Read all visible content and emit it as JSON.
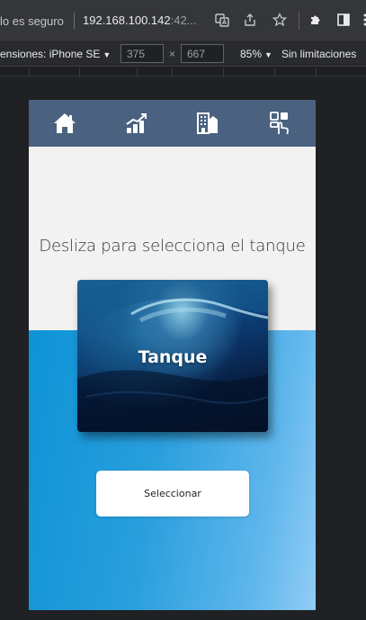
{
  "browser": {
    "security_text": "lo es seguro",
    "url_host": "192.168.100.142",
    "url_rest": ":42..."
  },
  "devtools": {
    "dimensions_label": "ensiones: iPhone SE",
    "width_value": "375",
    "height_value": "667",
    "times": "×",
    "zoom": "85%",
    "throttling": "Sin limitaciones",
    "arrow": "▼"
  },
  "app": {
    "nav_icons": [
      "home-icon",
      "chart-icon",
      "buildings-icon",
      "touch-grid-icon"
    ],
    "colors": {
      "nav_bg": "#4a6280",
      "top_bg": "#f2f2f2",
      "water_blue": "#0d93d6"
    },
    "prompt": "Desliza para selecciona el tanque",
    "card_title": "Tanque",
    "select_label": "Seleccionar"
  }
}
